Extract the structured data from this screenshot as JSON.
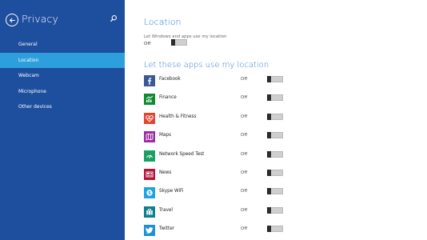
{
  "sidebar": {
    "title": "Privacy",
    "items": [
      {
        "label": "General",
        "active": false
      },
      {
        "label": "Location",
        "active": true
      },
      {
        "label": "Webcam",
        "active": false
      },
      {
        "label": "Microphone",
        "active": false
      },
      {
        "label": "Other devices",
        "active": false
      }
    ]
  },
  "main": {
    "title": "Location",
    "description": "Let Windows and apps use my location",
    "master_state": "Off",
    "apps_title": "Let these apps use my location",
    "apps": [
      {
        "name": "Facebook",
        "state": "Off",
        "icon": "facebook-icon",
        "color": "#3b5998"
      },
      {
        "name": "Finance",
        "state": "Off",
        "icon": "finance-icon",
        "color": "#0f8a2f"
      },
      {
        "name": "Health & Fitness",
        "state": "Off",
        "icon": "health-fitness-icon",
        "color": "#e2452e"
      },
      {
        "name": "Maps",
        "state": "Off",
        "icon": "maps-icon",
        "color": "#9a2c9f"
      },
      {
        "name": "Network Speed Test",
        "state": "Off",
        "icon": "network-speed-test-icon",
        "color": "#1aa064"
      },
      {
        "name": "News",
        "state": "Off",
        "icon": "news-icon",
        "color": "#b3163b"
      },
      {
        "name": "Skype WiFi",
        "state": "Off",
        "icon": "skype-wifi-icon",
        "color": "#1fa3e6"
      },
      {
        "name": "Travel",
        "state": "Off",
        "icon": "travel-icon",
        "color": "#107f8c"
      },
      {
        "name": "Twitter",
        "state": "Off",
        "icon": "twitter-icon",
        "color": "#1e90d9"
      }
    ]
  },
  "colors": {
    "sidebar_bg": "#1e4e9e",
    "sidebar_active": "#2d9fdc",
    "accent": "#2b7dd1"
  }
}
